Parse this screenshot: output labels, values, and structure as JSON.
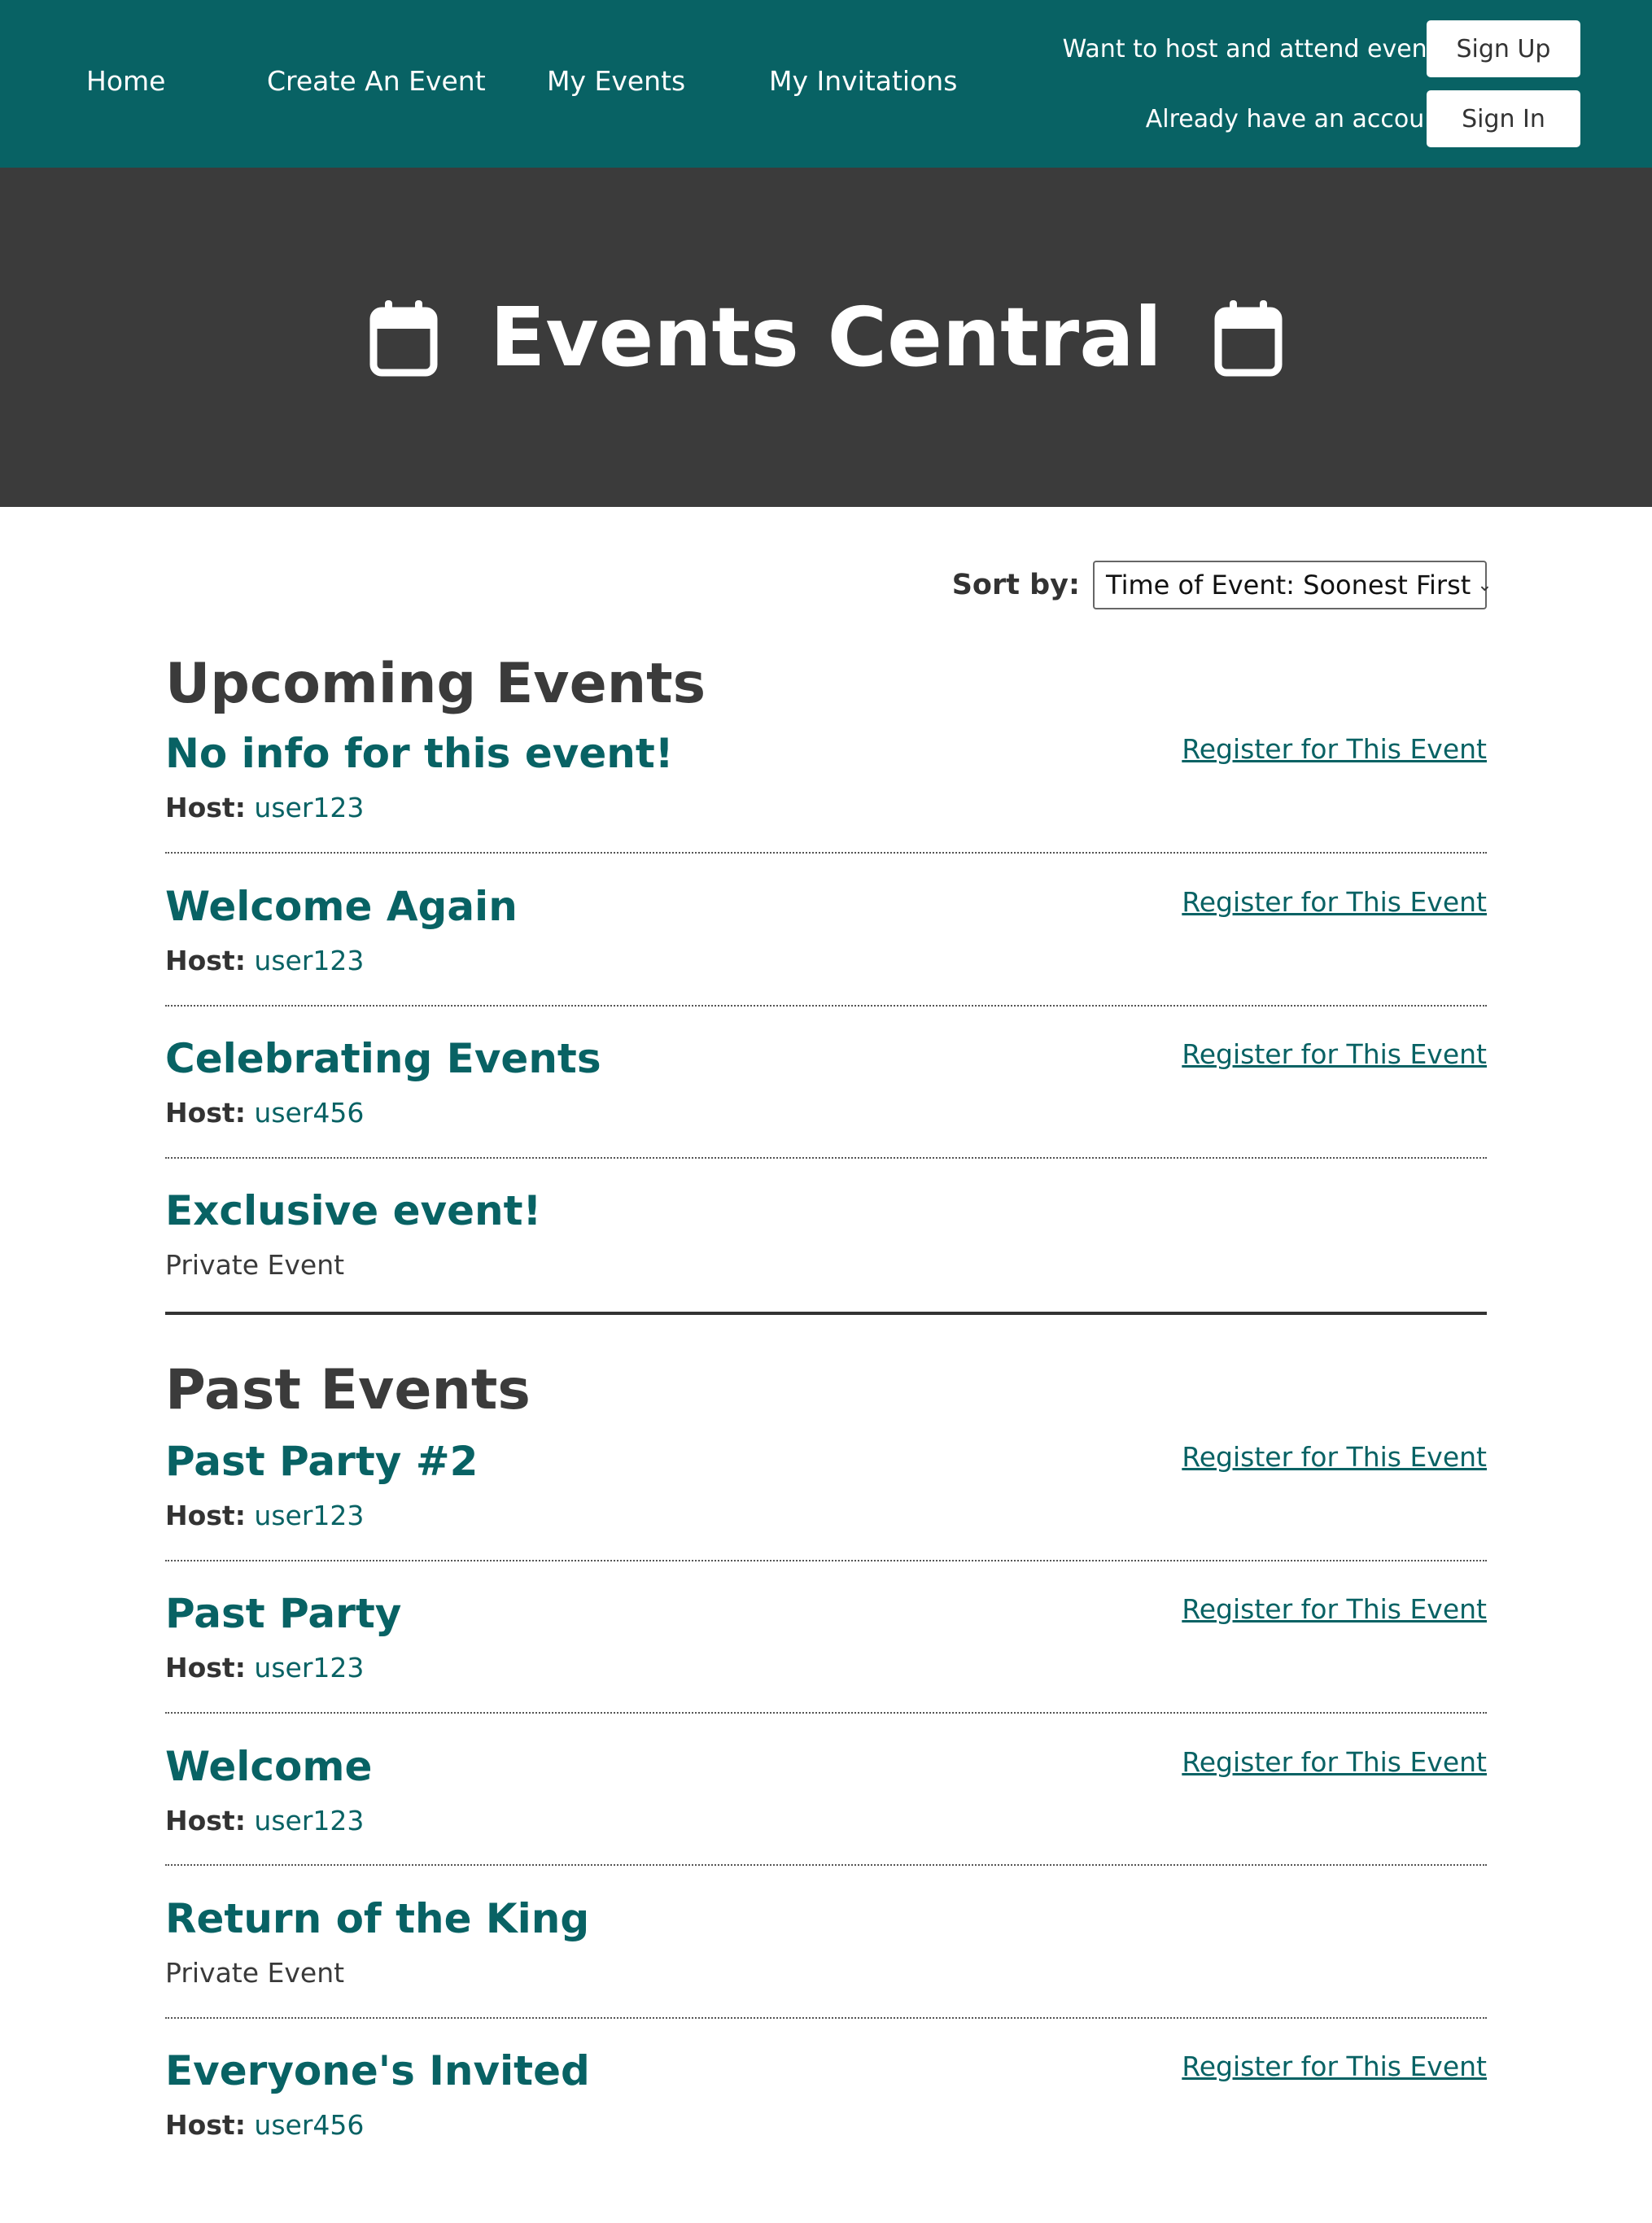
{
  "nav": {
    "links": [
      "Home",
      "Create An Event",
      "My Events",
      "My Invitations"
    ],
    "signup_prompt": "Want to host and attend events?",
    "signup_button": "Sign Up",
    "signin_prompt": "Already have an account?",
    "signin_button": "Sign In"
  },
  "hero": {
    "title": "Events Central",
    "icon": "calendar-icon"
  },
  "sort": {
    "label": "Sort by:",
    "selected": "Time of Event: Soonest First"
  },
  "upcoming": {
    "title": "Upcoming Events",
    "events": [
      {
        "title": "No info for this event!",
        "host_label": "Host:",
        "host": "user123",
        "register": "Register for This Event"
      },
      {
        "title": "Welcome Again",
        "host_label": "Host:",
        "host": "user123",
        "register": "Register for This Event"
      },
      {
        "title": "Celebrating Events",
        "host_label": "Host:",
        "host": "user456",
        "register": "Register for This Event"
      },
      {
        "title": "Exclusive event!",
        "note": "Private Event"
      }
    ]
  },
  "past": {
    "title": "Past Events",
    "events": [
      {
        "title": "Past Party #2",
        "host_label": "Host:",
        "host": "user123",
        "register": "Register for This Event"
      },
      {
        "title": "Past Party",
        "host_label": "Host:",
        "host": "user123",
        "register": "Register for This Event"
      },
      {
        "title": "Welcome",
        "host_label": "Host:",
        "host": "user123",
        "register": "Register for This Event"
      },
      {
        "title": "Return of the King",
        "note": "Private Event"
      },
      {
        "title": "Everyone's Invited",
        "host_label": "Host:",
        "host": "user456",
        "register": "Register for This Event"
      }
    ]
  },
  "colors": {
    "nav_bg": "#086264",
    "hero_bg": "#3b3b3b",
    "accent": "#086264",
    "text": "#3a3a3a"
  }
}
